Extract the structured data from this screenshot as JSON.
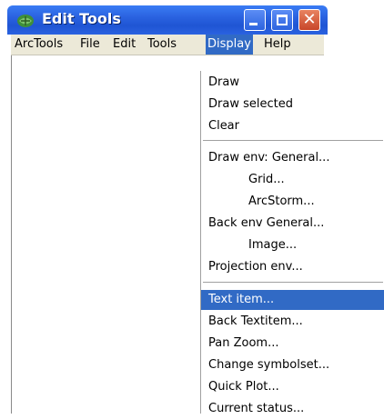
{
  "window": {
    "title": "Edit Tools"
  },
  "menubar": {
    "items": [
      "ArcTools",
      "File",
      "Edit",
      "Tools",
      "Display",
      "Help"
    ],
    "active": "Display"
  },
  "display_menu": {
    "group1": [
      "Draw",
      "Draw selected",
      "Clear"
    ],
    "group2": [
      "Draw env: General...",
      "Grid...",
      "ArcStorm...",
      "Back env  General...",
      "Image...",
      "Projection  env..."
    ],
    "group3": [
      "Text item...",
      "Back Textitem...",
      "Pan Zoom...",
      "Change symbolset...",
      "Quick Plot...",
      "Current status..."
    ],
    "highlighted": "Text item..."
  },
  "colors": {
    "titlebar": "#2a62e0",
    "menu_highlight": "#316ac5",
    "close_button": "#c8462a"
  },
  "icons": [
    "app-icon",
    "minimize-icon",
    "maximize-icon",
    "close-icon"
  ]
}
